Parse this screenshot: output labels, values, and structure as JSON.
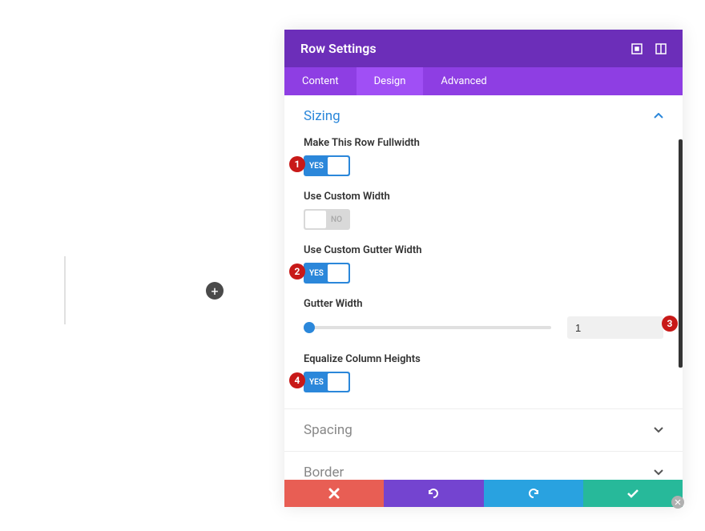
{
  "panel": {
    "title": "Row Settings",
    "tabs": [
      {
        "label": "Content",
        "active": false
      },
      {
        "label": "Design",
        "active": true
      },
      {
        "label": "Advanced",
        "active": false
      }
    ]
  },
  "sections": {
    "sizing": {
      "title": "Sizing",
      "expanded": true,
      "options": {
        "fullwidth": {
          "label": "Make This Row Fullwidth",
          "state": "YES",
          "badge": "1"
        },
        "customWidth": {
          "label": "Use Custom Width",
          "state": "NO"
        },
        "customGutter": {
          "label": "Use Custom Gutter Width",
          "state": "YES",
          "badge": "2"
        },
        "gutterWidth": {
          "label": "Gutter Width",
          "value": "1",
          "badge": "3"
        },
        "equalize": {
          "label": "Equalize Column Heights",
          "state": "YES",
          "badge": "4"
        }
      }
    },
    "spacing": {
      "title": "Spacing",
      "expanded": false
    },
    "border": {
      "title": "Border",
      "expanded": false
    }
  },
  "canvas": {
    "addSymbol": "+"
  }
}
